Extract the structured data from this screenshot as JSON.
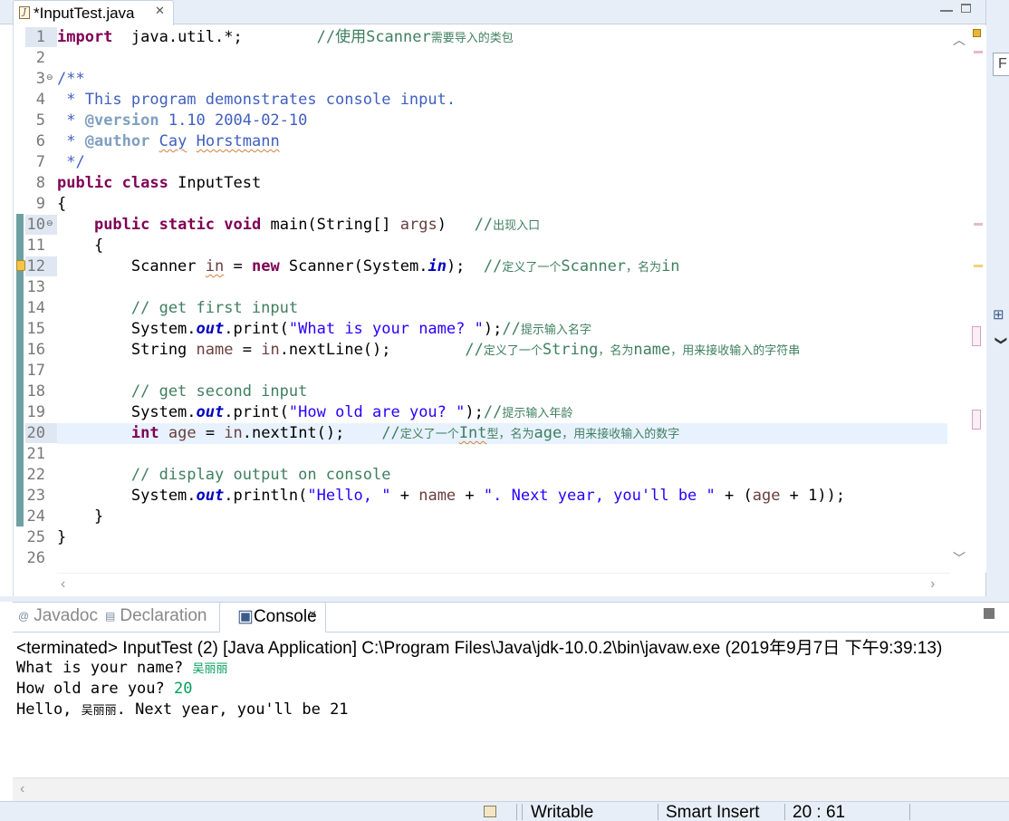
{
  "editor_tab": {
    "title": "*InputTest.java",
    "close": "✕"
  },
  "right_panel": {
    "field_text": "F",
    "outline_icon": "⊞",
    "chevron": "❯"
  },
  "code_lines": [
    {
      "n": "1",
      "frag": [
        [
          "kw",
          "import"
        ],
        [
          "",
          "  java.util.*;        "
        ],
        [
          "lc",
          "//使用"
        ],
        [
          "lc",
          "Scanner"
        ],
        [
          "lc zh",
          "需要导入的类包"
        ]
      ]
    },
    {
      "n": "2",
      "frag": []
    },
    {
      "n": "3",
      "fold": "⊖",
      "frag": [
        [
          "cm",
          "/**"
        ]
      ]
    },
    {
      "n": "4",
      "frag": [
        [
          "cm",
          " * This program demonstrates console input."
        ]
      ]
    },
    {
      "n": "5",
      "frag": [
        [
          "cm",
          " * "
        ],
        [
          "tag",
          "@version"
        ],
        [
          "cm",
          " 1.10 2004-02-10"
        ]
      ]
    },
    {
      "n": "6",
      "frag": [
        [
          "cm",
          " * "
        ],
        [
          "tag",
          "@author"
        ],
        [
          "cm",
          " "
        ],
        [
          "cm squig",
          "Cay"
        ],
        [
          "cm",
          " "
        ],
        [
          "cm squig",
          "Horstmann"
        ]
      ]
    },
    {
      "n": "7",
      "frag": [
        [
          "cm",
          " */"
        ]
      ]
    },
    {
      "n": "8",
      "frag": [
        [
          "kw",
          "public"
        ],
        [
          "",
          " "
        ],
        [
          "kw",
          "class"
        ],
        [
          "",
          " InputTest"
        ]
      ]
    },
    {
      "n": "9",
      "frag": [
        [
          "",
          "{"
        ]
      ]
    },
    {
      "n": "10",
      "fold": "⊖",
      "frag": [
        [
          "",
          "    "
        ],
        [
          "kw",
          "public"
        ],
        [
          "",
          " "
        ],
        [
          "kw",
          "static"
        ],
        [
          "",
          " "
        ],
        [
          "kw",
          "void"
        ],
        [
          "",
          " main(String[] "
        ],
        [
          "pv",
          "args"
        ],
        [
          "",
          ")   "
        ],
        [
          "lc",
          "//"
        ],
        [
          "lc zh",
          "出现入口"
        ]
      ]
    },
    {
      "n": "11",
      "frag": [
        [
          "",
          "    {"
        ]
      ]
    },
    {
      "n": "12",
      "warn": true,
      "frag": [
        [
          "",
          "        Scanner "
        ],
        [
          "pv squig",
          "in"
        ],
        [
          "",
          " = "
        ],
        [
          "kw",
          "new"
        ],
        [
          "",
          " Scanner(System."
        ],
        [
          "sf",
          "in"
        ],
        [
          "",
          ");  "
        ],
        [
          "lc",
          "//"
        ],
        [
          "lc zh",
          "定义了一个"
        ],
        [
          "lc",
          "Scanner"
        ],
        [
          "lc zh",
          "，名为"
        ],
        [
          "lc",
          "in"
        ]
      ]
    },
    {
      "n": "13",
      "frag": []
    },
    {
      "n": "14",
      "frag": [
        [
          "lc",
          "        // get first input"
        ]
      ]
    },
    {
      "n": "15",
      "frag": [
        [
          "",
          "        System."
        ],
        [
          "sf",
          "out"
        ],
        [
          "",
          ".print("
        ],
        [
          "st",
          "\"What is your name? \""
        ],
        [
          "",
          ");"
        ],
        [
          "lc",
          "//"
        ],
        [
          "lc zh",
          "提示输入名字"
        ]
      ]
    },
    {
      "n": "16",
      "frag": [
        [
          "",
          "        String "
        ],
        [
          "pv",
          "name"
        ],
        [
          "",
          " = "
        ],
        [
          "pv",
          "in"
        ],
        [
          "",
          ".nextLine();        "
        ],
        [
          "lc",
          "//"
        ],
        [
          "lc zh",
          "定义了一个"
        ],
        [
          "lc",
          "String"
        ],
        [
          "lc zh",
          "，名为"
        ],
        [
          "lc",
          "name"
        ],
        [
          "lc zh",
          "，用来接收输入的字符串"
        ]
      ]
    },
    {
      "n": "17",
      "frag": []
    },
    {
      "n": "18",
      "frag": [
        [
          "lc",
          "        // get second input"
        ]
      ]
    },
    {
      "n": "19",
      "frag": [
        [
          "",
          "        System."
        ],
        [
          "sf",
          "out"
        ],
        [
          "",
          ".print("
        ],
        [
          "st",
          "\"How old are you? \""
        ],
        [
          "",
          ");"
        ],
        [
          "lc",
          "//"
        ],
        [
          "lc zh",
          "提示输入年龄"
        ]
      ]
    },
    {
      "n": "20",
      "current": true,
      "frag": [
        [
          "",
          "        "
        ],
        [
          "kw",
          "int"
        ],
        [
          "",
          " "
        ],
        [
          "pv",
          "age"
        ],
        [
          "",
          " = "
        ],
        [
          "pv",
          "in"
        ],
        [
          "",
          ".nextInt();    "
        ],
        [
          "lc",
          "//"
        ],
        [
          "lc zh",
          "定义了一个"
        ],
        [
          "lc squig",
          "Int"
        ],
        [
          "lc zh",
          "型，名为"
        ],
        [
          "lc",
          "age"
        ],
        [
          "lc zh",
          "，用来接收输入的数字"
        ]
      ]
    },
    {
      "n": "21",
      "frag": []
    },
    {
      "n": "22",
      "frag": [
        [
          "lc",
          "        // display output on console"
        ]
      ]
    },
    {
      "n": "23",
      "frag": [
        [
          "",
          "        System."
        ],
        [
          "sf",
          "out"
        ],
        [
          "",
          ".println("
        ],
        [
          "st",
          "\"Hello, \""
        ],
        [
          "",
          " + "
        ],
        [
          "pv",
          "name"
        ],
        [
          "",
          " + "
        ],
        [
          "st",
          "\". Next year, you'll be \""
        ],
        [
          "",
          " + ("
        ],
        [
          "pv",
          "age"
        ],
        [
          "",
          " + 1));"
        ]
      ]
    },
    {
      "n": "24",
      "frag": [
        [
          "",
          "    }"
        ]
      ]
    },
    {
      "n": "25",
      "frag": [
        [
          "",
          "}"
        ]
      ]
    },
    {
      "n": "26",
      "frag": []
    }
  ],
  "panel_tabs": {
    "javadoc": "Javadoc",
    "declaration": "Declaration",
    "console": "Console",
    "close": "✕"
  },
  "console": {
    "status": "<terminated> InputTest (2) [Java Application] C:\\Program Files\\Java\\jdk-10.0.2\\bin\\javaw.exe (2019年9月7日 下午9:39:13)",
    "line1_prompt": "What is your name? ",
    "line1_input": "吴丽丽",
    "line2_prompt": "How old are you? ",
    "line2_input": "20",
    "line3_a": "Hello, ",
    "line3_name": "吴丽丽",
    "line3_b": ". Next year, you'll be 21"
  },
  "statusbar": {
    "writable": "Writable",
    "insert_mode": "Smart Insert",
    "position": "20 : 61"
  },
  "colors": {
    "keyword": "#7f0055",
    "comment": "#3f5fbf",
    "line_comment": "#3f7f5f",
    "string": "#2a00ff",
    "static_field": "#0000c0",
    "console_input": "#00a05a"
  }
}
